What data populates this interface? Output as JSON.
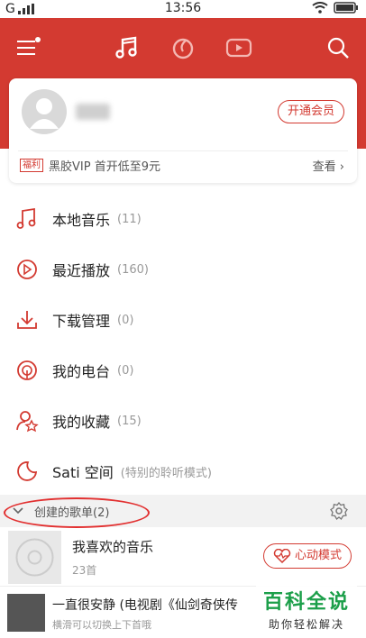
{
  "status_bar": {
    "carrier": "G",
    "signal": "ull",
    "time": "13:56"
  },
  "profile": {
    "vip_button": "开通会员",
    "promo_tag": "福利",
    "promo_text": "黑胶VIP 首开低至9元",
    "promo_link": "查看"
  },
  "menu": [
    {
      "label": "本地音乐",
      "count": "(11)",
      "icon": "music-note-icon"
    },
    {
      "label": "最近播放",
      "count": "(160)",
      "icon": "recent-play-icon"
    },
    {
      "label": "下载管理",
      "count": "(0)",
      "icon": "download-icon"
    },
    {
      "label": "我的电台",
      "count": "(0)",
      "icon": "radio-icon"
    },
    {
      "label": "我的收藏",
      "count": "(15)",
      "icon": "star-person-icon"
    },
    {
      "label": "Sati 空间",
      "count": "(特别的聆听模式)",
      "icon": "moon-icon"
    }
  ],
  "created_playlists": {
    "title": "创建的歌单(2)"
  },
  "playlists": [
    {
      "name": "我喜欢的音乐",
      "count": "23首",
      "mode_button": "心动模式"
    }
  ],
  "now_playing": {
    "title": "一直很安静 (电视剧《仙剑奇侠传",
    "subtitle": "横滑可以切换上下首哦"
  },
  "watermark": {
    "main": "百科全说",
    "sub": "助你轻松解决"
  },
  "colors": {
    "accent": "#d33a31",
    "watermark_green": "#1c9f4a"
  }
}
